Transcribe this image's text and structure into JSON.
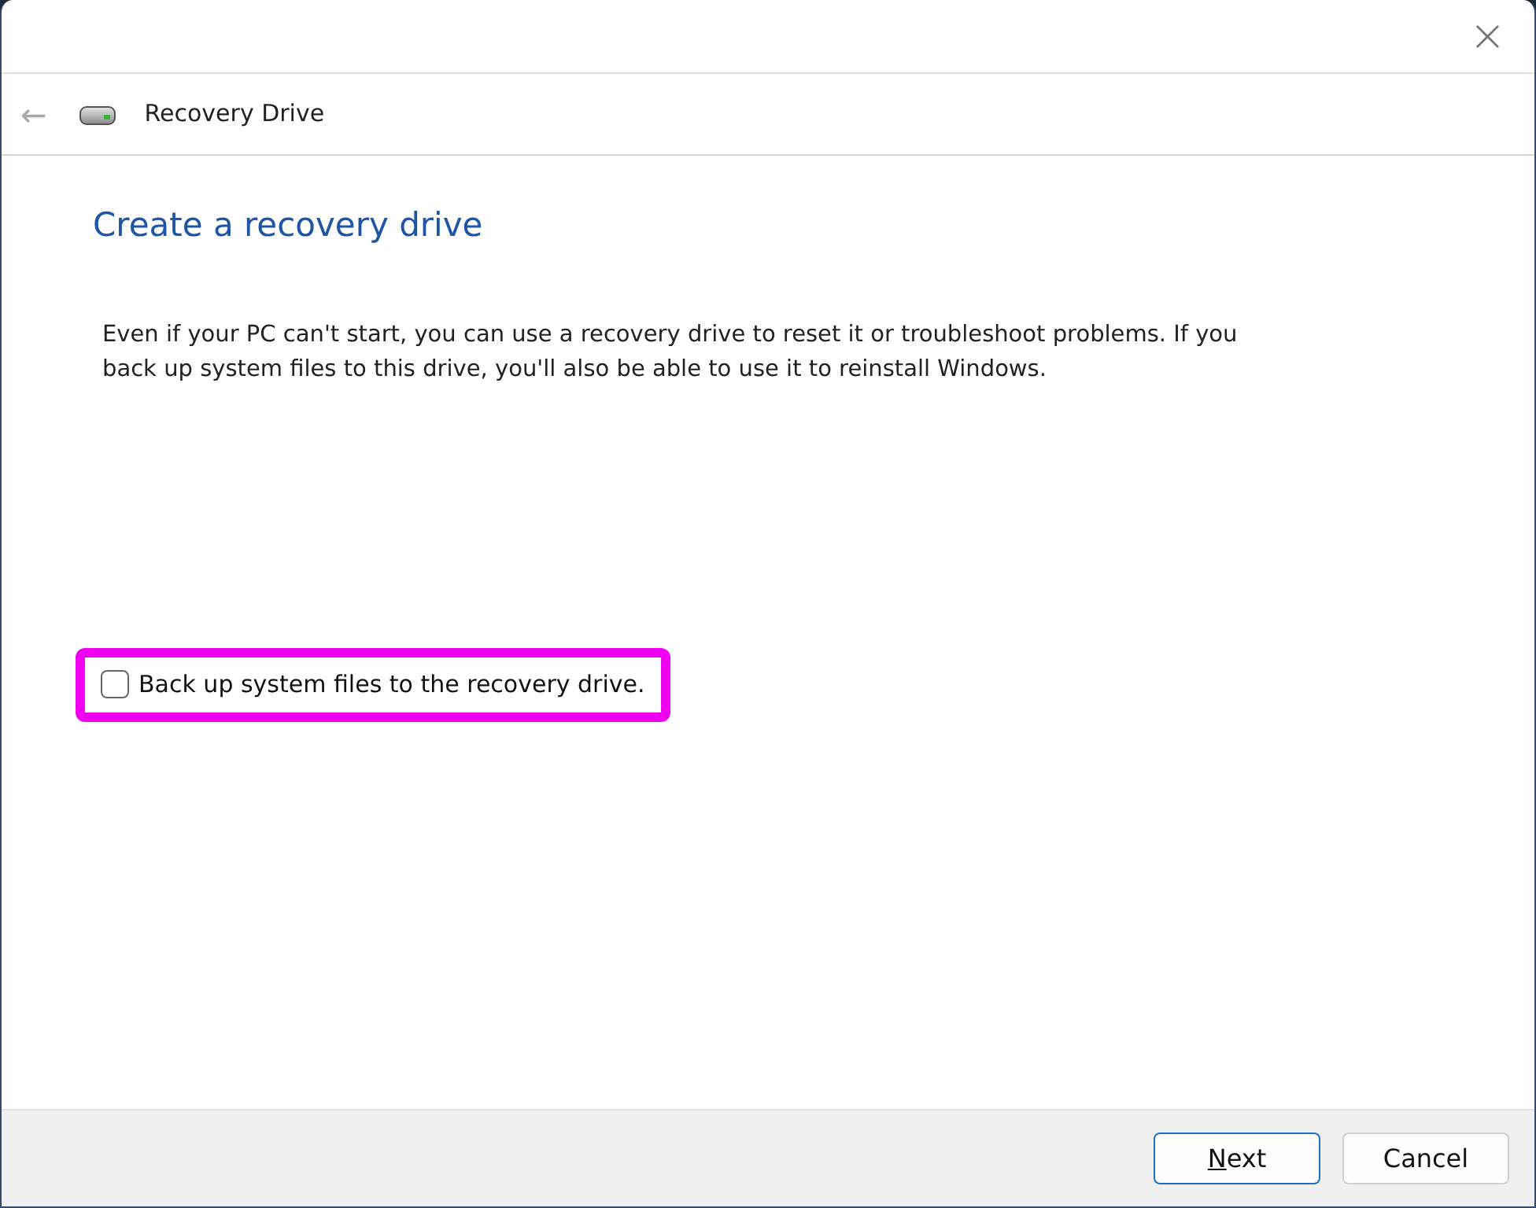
{
  "window": {
    "close_glyph": "×"
  },
  "header": {
    "back_glyph": "←",
    "back_disabled": true,
    "title": "Recovery Drive"
  },
  "content": {
    "heading": "Create a recovery drive",
    "description": "Even if your PC can't start, you can use a recovery drive to reset it or troubleshoot problems. If you back up system files to this drive, you'll also be able to use it to reinstall Windows.",
    "option": {
      "label": "Back up system files to the recovery drive.",
      "checked": false,
      "highlighted": true
    }
  },
  "buttons": [
    {
      "label": "Next",
      "default": true,
      "underline_first": true
    },
    {
      "label": "Cancel",
      "default": false,
      "underline_first": false
    }
  ]
}
